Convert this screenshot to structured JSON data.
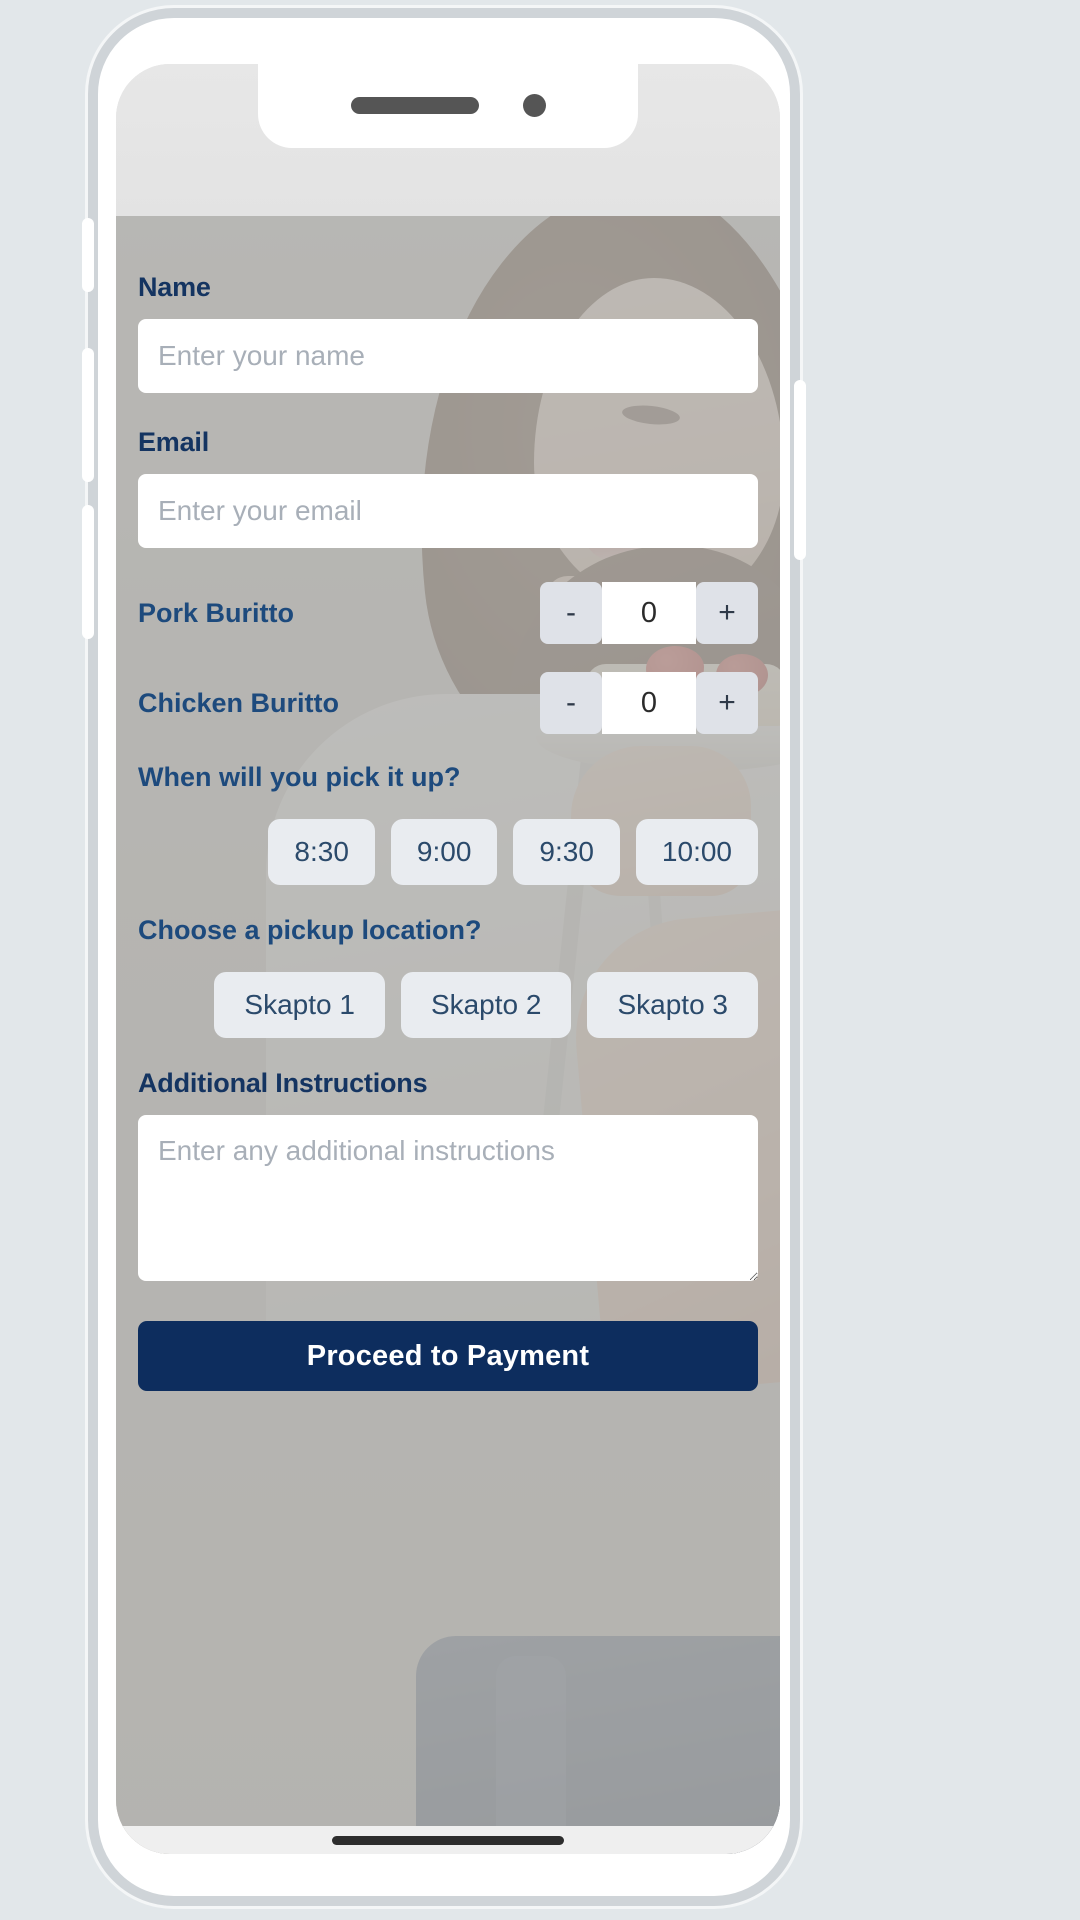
{
  "device": {
    "notch": {
      "speaker": "speaker-bar",
      "camera": "camera-dot"
    },
    "buttons": {
      "silent": "silent-switch",
      "volume_up": "volume-up-button",
      "volume_down": "volume-down-button",
      "power": "power-button"
    }
  },
  "theme": {
    "navy": "#0d2d5e",
    "label_navy": "#143461",
    "text_blue": "#1d4a7d",
    "chip_bg": "#e9ecf0",
    "stepper_bg": "#dfe2e8",
    "overlay_grey": "#afafac",
    "input_bg": "#ffffff",
    "placeholder_grey": "#a8afb8"
  },
  "form": {
    "name": {
      "label": "Name",
      "placeholder": "Enter your name",
      "value": ""
    },
    "email": {
      "label": "Email",
      "placeholder": "Enter your email",
      "value": ""
    },
    "items": [
      {
        "label": "Pork Buritto",
        "decrement": "-",
        "quantity": "0",
        "increment": "+"
      },
      {
        "label": "Chicken Buritto",
        "decrement": "-",
        "quantity": "0",
        "increment": "+"
      }
    ],
    "pickup_time": {
      "question": "When will you pick it up?",
      "options": [
        "8:30",
        "9:00",
        "9:30",
        "10:00"
      ]
    },
    "pickup_location": {
      "question": "Choose a pickup location?",
      "options": [
        "Skapto 1",
        "Skapto 2",
        "Skapto 3"
      ]
    },
    "instructions": {
      "label": "Additional Instructions",
      "placeholder": "Enter any additional instructions",
      "value": ""
    },
    "submit_label": "Proceed to Payment"
  }
}
